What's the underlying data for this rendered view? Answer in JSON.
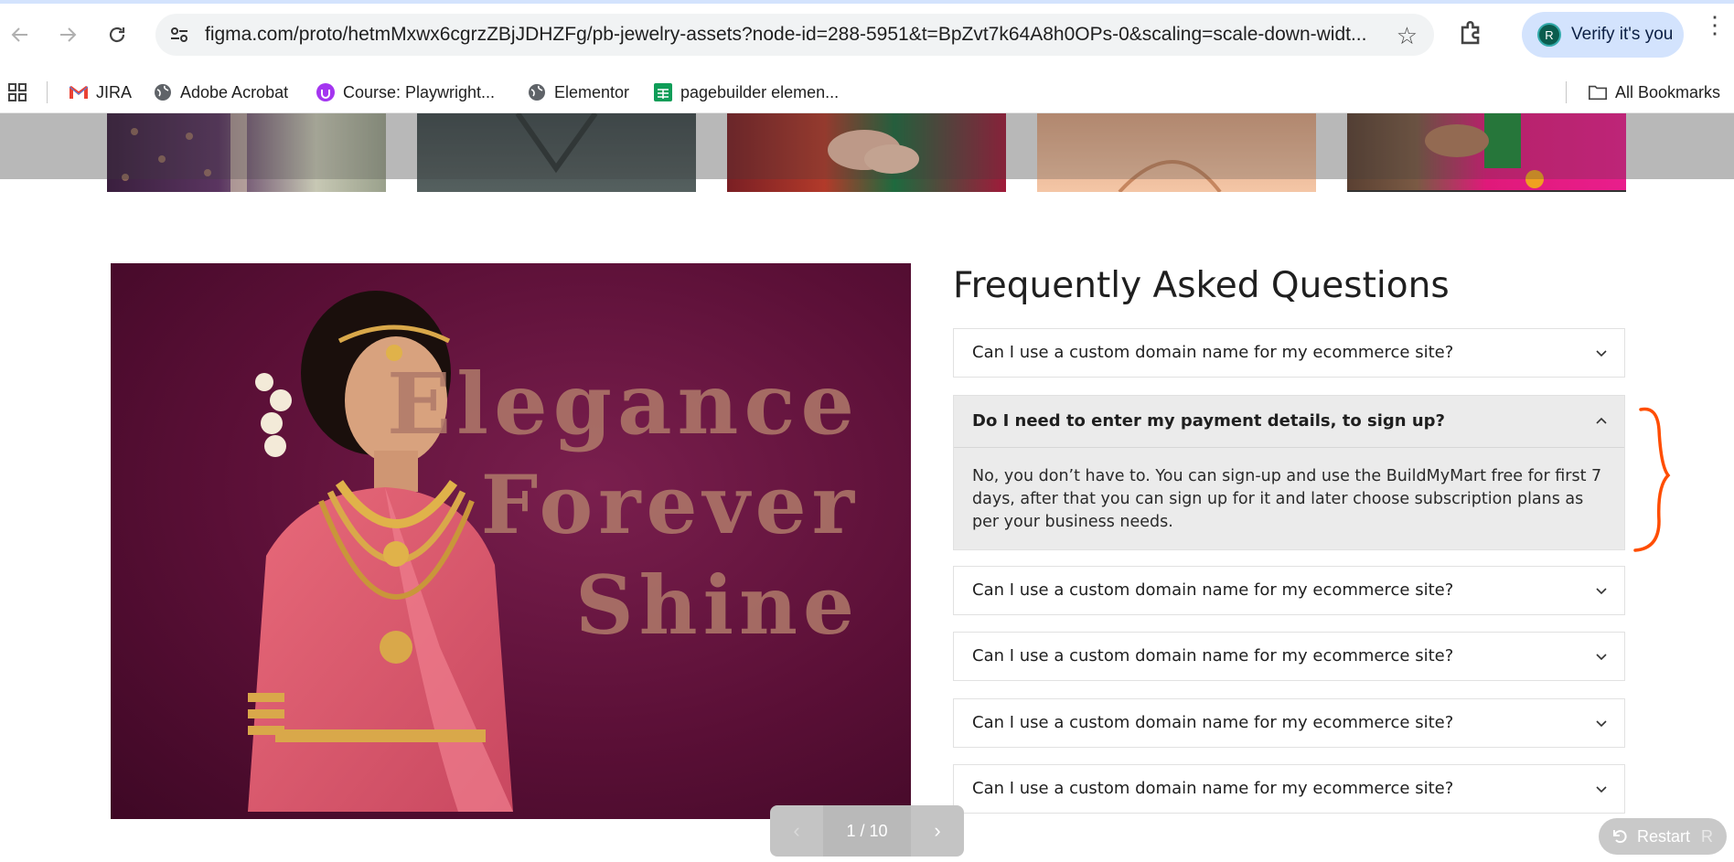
{
  "browser": {
    "url": "figma.com/proto/hetmMxwx6cgrzZBjJDHZFg/pb-jewelry-assets?node-id=288-5951&t=BpZvt7k64A8h0OPs-0&scaling=scale-down-widt...",
    "verify_label": "Verify it's you",
    "avatar_initial": "R",
    "icons": {
      "back": "arrow-left-icon",
      "forward": "arrow-right-icon",
      "reload": "reload-icon",
      "star": "star-icon",
      "extensions": "puzzle-icon",
      "menu": "kebab-icon"
    }
  },
  "bookmarks": {
    "items": [
      {
        "label": "JIRA",
        "icon": "gmail-icon"
      },
      {
        "label": "Adobe Acrobat",
        "icon": "globe-icon"
      },
      {
        "label": "Course: Playwright...",
        "icon": "udemy-icon"
      },
      {
        "label": "Elementor",
        "icon": "globe-icon"
      },
      {
        "label": "pagebuilder elemen...",
        "icon": "sheets-icon"
      }
    ],
    "all_bookmarks": "All Bookmarks"
  },
  "hero": {
    "lines": [
      "Elegance",
      "Forever",
      "Shine"
    ]
  },
  "faq": {
    "title": "Frequently Asked Questions",
    "items": [
      {
        "question": "Can I use a custom domain name for my ecommerce site?"
      },
      {
        "question": "Do I need to enter my payment details, to sign up?",
        "answer": "No, you don’t have to. You can sign-up and use the BuildMyMart free for first 7 days, after that you can  sign up for it and later choose subscription plans as per your business needs."
      },
      {
        "question": "Can I use a custom domain name for my ecommerce site?"
      },
      {
        "question": "Can I use a custom domain name for my ecommerce site?"
      },
      {
        "question": "Can I use a custom domain name for my ecommerce site?"
      },
      {
        "question": "Can I use a custom domain name for my ecommerce site?"
      }
    ]
  },
  "pager": {
    "label": "1 / 10"
  },
  "restart": {
    "label": "Restart",
    "suffix": "R"
  },
  "colors": {
    "accent_blue": "#d3e3fd",
    "annotation_orange": "#ff4d00",
    "hero_bg": "#5a0f36"
  }
}
